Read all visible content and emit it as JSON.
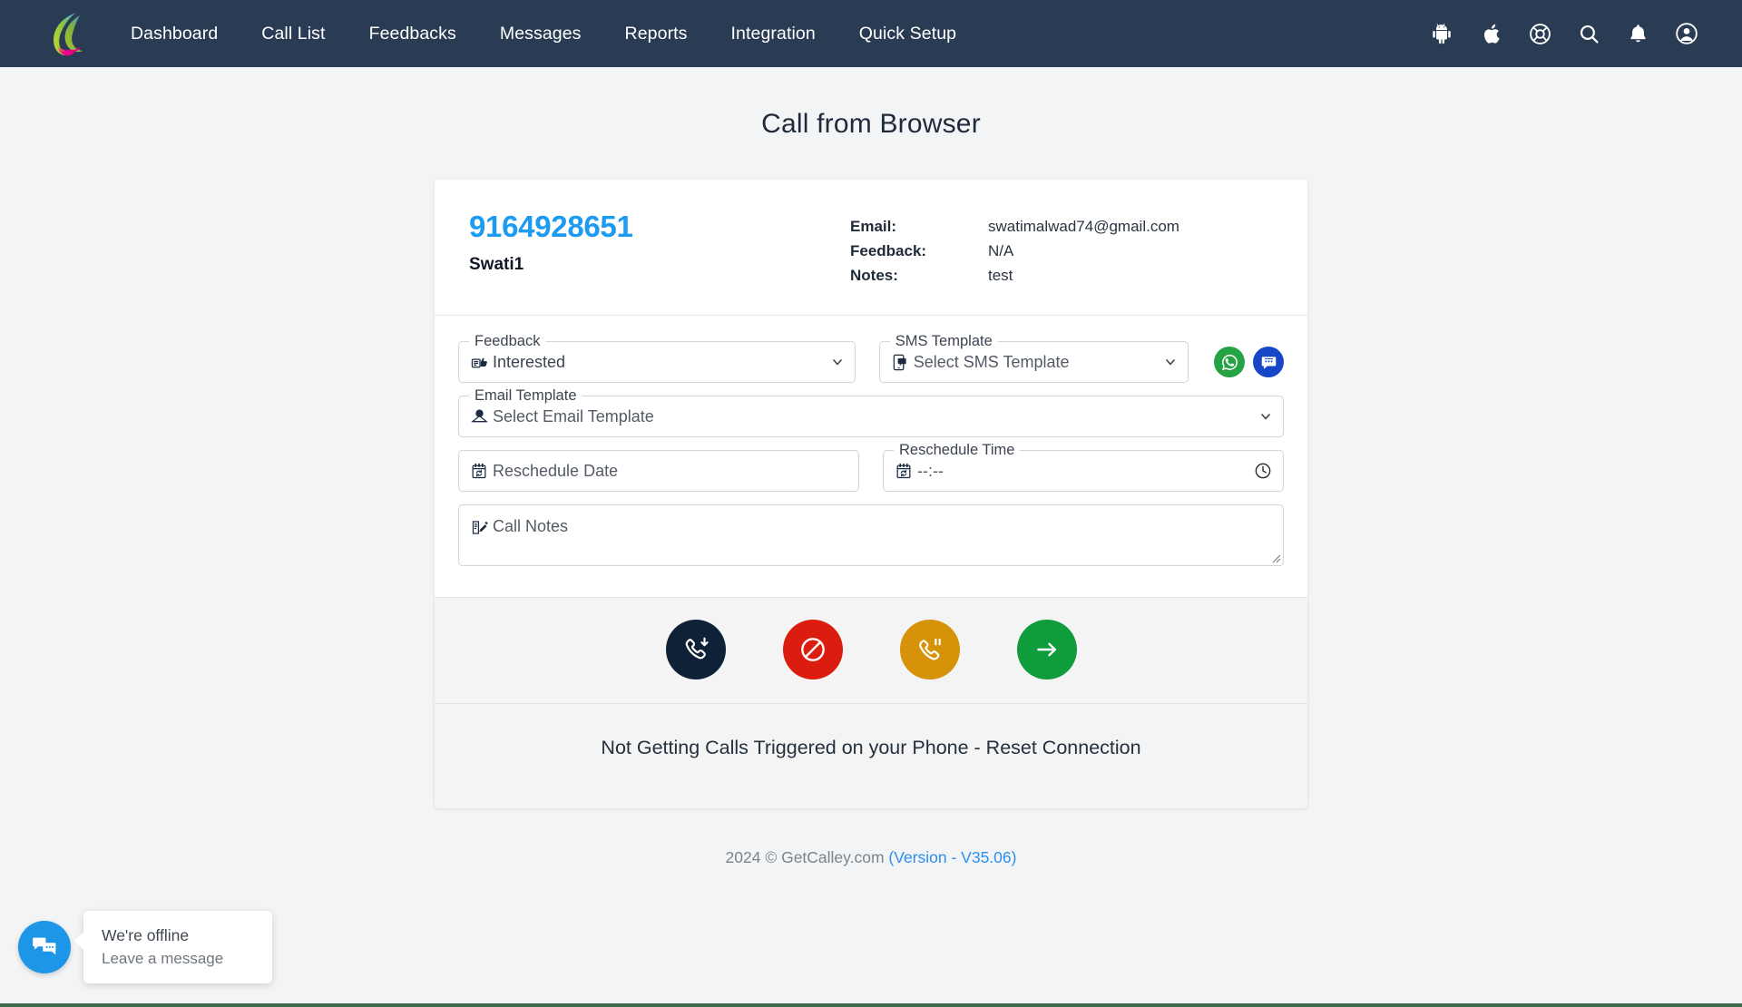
{
  "navbar": {
    "logo_name": "calley-logo",
    "links": [
      {
        "label": "Dashboard"
      },
      {
        "label": "Call List"
      },
      {
        "label": "Feedbacks"
      },
      {
        "label": "Messages"
      },
      {
        "label": "Reports"
      },
      {
        "label": "Integration"
      },
      {
        "label": "Quick Setup"
      }
    ],
    "icons": [
      {
        "name": "android-icon"
      },
      {
        "name": "apple-icon"
      },
      {
        "name": "life-ring-support-icon"
      },
      {
        "name": "search-icon"
      },
      {
        "name": "notification-bell-icon"
      },
      {
        "name": "user-account-icon"
      }
    ],
    "background_color": "#2a3c53"
  },
  "page": {
    "title": "Call from Browser"
  },
  "contact": {
    "phone": "9164928651",
    "phone_color": "#1d9bf0",
    "name": "Swati1",
    "email_label": "Email:",
    "email_value": "swatimalwad74@gmail.com",
    "feedback_label": "Feedback:",
    "feedback_value": "N/A",
    "notes_label": "Notes:",
    "notes_value": "test"
  },
  "form": {
    "feedback": {
      "legend": "Feedback",
      "value": "Interested",
      "icon": "thumbs-up-note-icon"
    },
    "sms_template": {
      "legend": "SMS Template",
      "value": "Select SMS Template",
      "icon": "mobile-message-icon"
    },
    "whatsapp_button": {
      "name": "whatsapp-send-button",
      "color": "#25a244"
    },
    "sms_button": {
      "name": "sms-send-button",
      "color": "#1746c8"
    },
    "email_template": {
      "legend": "Email Template",
      "value": "Select Email Template",
      "icon": "email-at-envelope-icon"
    },
    "reschedule_date": {
      "placeholder": "Reschedule Date",
      "icon": "calendar-refresh-icon"
    },
    "reschedule_time": {
      "legend": "Reschedule Time",
      "value": "--:--",
      "icon": "calendar-refresh-icon",
      "trailing_icon": "clock-icon"
    },
    "call_notes": {
      "placeholder": "Call Notes",
      "icon": "note-pen-icon"
    }
  },
  "actions": [
    {
      "name": "call-download-button",
      "label": "Call",
      "color": "#0f2136",
      "icon": "phone-download-icon"
    },
    {
      "name": "block-call-button",
      "label": "Block",
      "color": "#dc1c0f",
      "icon": "ban-icon"
    },
    {
      "name": "pause-call-button",
      "label": "Pause",
      "color": "#d69208",
      "icon": "phone-pause-icon"
    },
    {
      "name": "next-call-button",
      "label": "Next",
      "color": "#0f9d3c",
      "icon": "arrow-right-icon"
    }
  ],
  "reset": {
    "text": "Not Getting Calls Triggered on your Phone - Reset Connection"
  },
  "footer": {
    "copyright": "2024 © GetCalley.com",
    "version": "(Version - V35.06)"
  },
  "chat": {
    "button_icon": "chat-bubbles-icon",
    "title": "We're offline",
    "subtitle": "Leave a message"
  }
}
